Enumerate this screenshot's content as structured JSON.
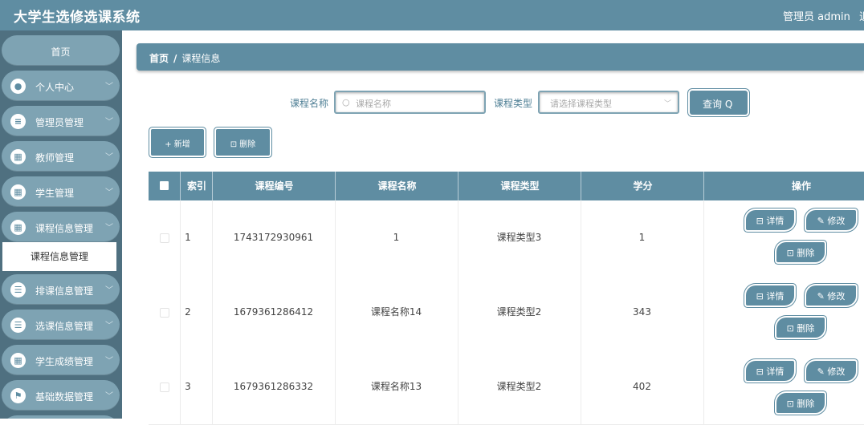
{
  "app": {
    "title": "大学生选修选课系统",
    "user": "管理员 admin",
    "logout": "退"
  },
  "sidebar": {
    "home": "首页",
    "items": [
      {
        "label": "个人中心",
        "icon": "user-icon"
      },
      {
        "label": "管理员管理",
        "icon": "admin-icon"
      },
      {
        "label": "教师管理",
        "icon": "grid-icon"
      },
      {
        "label": "学生管理",
        "icon": "grid-icon"
      },
      {
        "label": "课程信息管理",
        "icon": "grid-icon"
      },
      {
        "label": "排课信息管理",
        "icon": "list-icon"
      },
      {
        "label": "选课信息管理",
        "icon": "list-icon"
      },
      {
        "label": "学生成绩管理",
        "icon": "grid-icon"
      },
      {
        "label": "基础数据管理",
        "icon": "flag-icon"
      }
    ],
    "active_sub": "课程信息管理"
  },
  "breadcrumb": {
    "home": "首页",
    "sep": "/",
    "current": "课程信息"
  },
  "search": {
    "name_label": "课程名称",
    "name_placeholder": "课程名称",
    "type_label": "课程类型",
    "type_placeholder": "请选择课程类型",
    "query_button": "查询 Q"
  },
  "actions": {
    "add": "+ 新增",
    "delete": "⊡ 删除"
  },
  "table": {
    "headers": [
      "索引",
      "课程编号",
      "课程名称",
      "课程类型",
      "学分",
      "操作"
    ],
    "rows": [
      {
        "index": "1",
        "code": "1743172930961",
        "name": "1",
        "type": "课程类型3",
        "credit": "1"
      },
      {
        "index": "2",
        "code": "1679361286412",
        "name": "课程名称14",
        "type": "课程类型2",
        "credit": "343"
      },
      {
        "index": "3",
        "code": "1679361286332",
        "name": "课程名称13",
        "type": "课程类型2",
        "credit": "402"
      }
    ],
    "op_detail": "⊟ 详情",
    "op_edit": "✎ 修改",
    "op_delete": "⊡ 删除"
  },
  "colors": {
    "primary": "#5f8da2",
    "sidebar_bg": "#4f7080",
    "nav_item": "#7ea3b3"
  }
}
